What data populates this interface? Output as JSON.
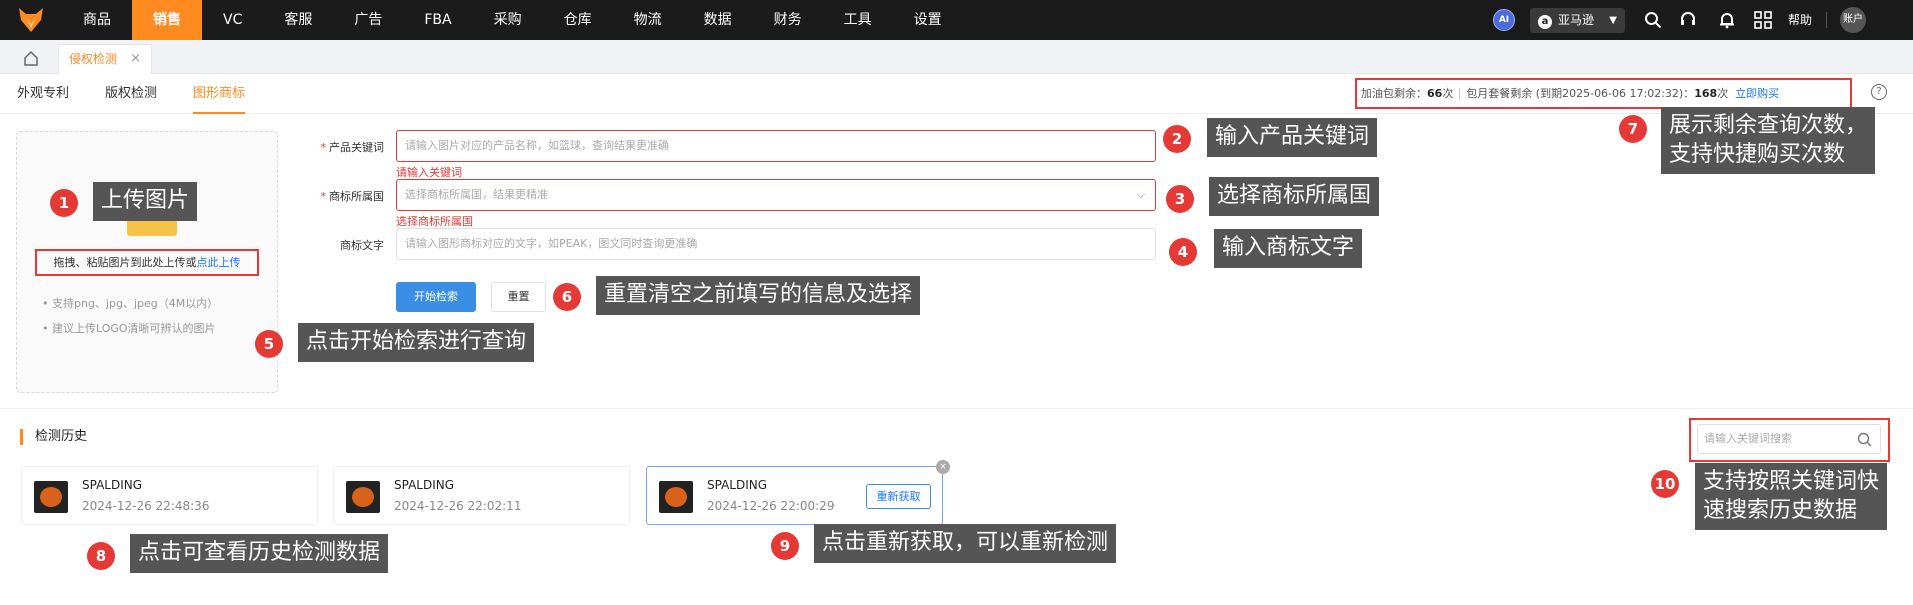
{
  "nav": {
    "items": [
      {
        "label": "商品"
      },
      {
        "label": "销售",
        "active": true
      },
      {
        "label": "VC"
      },
      {
        "label": "客服"
      },
      {
        "label": "广告"
      },
      {
        "label": "FBA"
      },
      {
        "label": "采购"
      },
      {
        "label": "仓库"
      },
      {
        "label": "物流"
      },
      {
        "label": "数据"
      },
      {
        "label": "财务"
      },
      {
        "label": "工具"
      },
      {
        "label": "设置"
      }
    ],
    "ai_label": "AI",
    "store_label": "亚马逊",
    "help_label": "帮助",
    "account_label": "账户"
  },
  "tabs": {
    "current_label": "侵权检测",
    "close_glyph": "×"
  },
  "subtabs": [
    {
      "label": "外观专利"
    },
    {
      "label": "版权检测"
    },
    {
      "label": "图形商标",
      "active": true
    }
  ],
  "quota": {
    "fuel_label": "加油包剩余：",
    "fuel_count": "66",
    "fuel_unit": "次",
    "monthly_label": "包月套餐剩余 (到期2025-06-06 17:02:32)：",
    "monthly_count": "168",
    "monthly_unit": "次",
    "buy_label": "立即购买"
  },
  "upload": {
    "prompt": "拖拽、粘贴图片到此处上传或",
    "link": "点此上传",
    "tips": [
      "• 支持png、jpg、jpeg（4M以内）",
      "• 建议上传LOGO清晰可辨认的图片"
    ]
  },
  "form": {
    "keyword": {
      "label": "产品关键词",
      "placeholder": "请输入图片对应的产品名称，如篮球，查询结果更准确",
      "error": "请输入关键词"
    },
    "country": {
      "label": "商标所属国",
      "placeholder": "选择商标所属国，结果更精准",
      "error": "选择商标所属国"
    },
    "text": {
      "label": "商标文字",
      "placeholder": "请输入图形商标对应的文字，如PEAK，图文同时查询更准确"
    },
    "search_button": "开始检索",
    "reset_button": "重置"
  },
  "history": {
    "title": "检测历史",
    "search_placeholder": "请输入关键词搜索",
    "items": [
      {
        "name": "SPALDING",
        "date": "2024-12-26 22:48:36"
      },
      {
        "name": "SPALDING",
        "date": "2024-12-26 22:02:11"
      },
      {
        "name": "SPALDING",
        "date": "2024-12-26 22:00:29"
      }
    ],
    "refetch_label": "重新获取",
    "close_glyph": "×"
  },
  "annotations": [
    {
      "num": "1",
      "text": "上传图片"
    },
    {
      "num": "2",
      "text": "输入产品关键词"
    },
    {
      "num": "3",
      "text": "选择商标所属国"
    },
    {
      "num": "4",
      "text": "输入商标文字"
    },
    {
      "num": "5",
      "text": "点击开始检索进行查询"
    },
    {
      "num": "6",
      "text": "重置清空之前填写的信息及选择"
    },
    {
      "num": "7",
      "line1": "展示剩余查询次数，",
      "line2": "支持快捷购买次数"
    },
    {
      "num": "8",
      "text": "点击可查看历史检测数据"
    },
    {
      "num": "9",
      "text": "点击重新获取，可以重新检测"
    },
    {
      "num": "10",
      "line1": "支持按照关键词快",
      "line2": "速搜索历史数据"
    }
  ],
  "colors": {
    "brand": "#ff8a1f",
    "nav_bg": "#1b1b1b",
    "primary": "#3a8ee6",
    "error": "#e53935",
    "annotation_bg": "#555555"
  },
  "icons": [
    "fox-logo-icon",
    "amazon-icon",
    "search-icon",
    "headset-icon",
    "bell-icon",
    "apps-grid-icon",
    "home-icon",
    "help-circle-icon",
    "chevron-down-icon",
    "close-icon"
  ]
}
